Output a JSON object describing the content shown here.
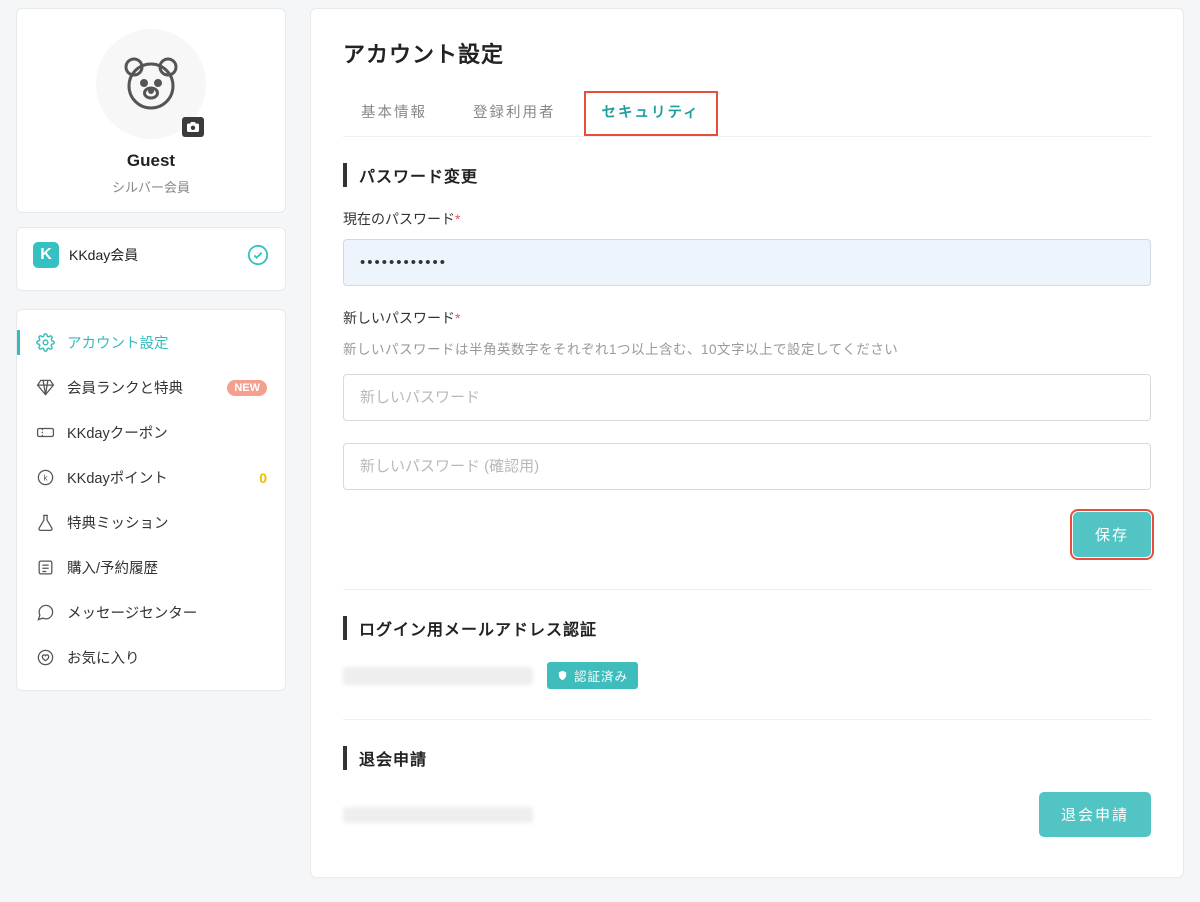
{
  "sidebar": {
    "username": "Guest",
    "member_tier": "シルバー会員",
    "member_card_title": "KKday会員",
    "nav": [
      {
        "label": "アカウント設定"
      },
      {
        "label": "会員ランクと特典",
        "badge": "NEW"
      },
      {
        "label": "KKdayクーポン"
      },
      {
        "label": "KKdayポイント",
        "points": "0"
      },
      {
        "label": "特典ミッション"
      },
      {
        "label": "購入/予約履歴"
      },
      {
        "label": "メッセージセンター"
      },
      {
        "label": "お気に入り"
      }
    ]
  },
  "main": {
    "title": "アカウント設定",
    "tabs": [
      {
        "label": "基本情報"
      },
      {
        "label": "登録利用者"
      },
      {
        "label": "セキュリティ"
      }
    ],
    "password_section": {
      "heading": "パスワード変更",
      "current_label": "現在のパスワード",
      "current_value": "••••••••••••",
      "new_label": "新しいパスワード",
      "helper": "新しいパスワードは半角英数字をそれぞれ1つ以上含む、10文字以上で設定してください",
      "new_placeholder": "新しいパスワード",
      "confirm_placeholder": "新しいパスワード (確認用)",
      "save_label": "保存"
    },
    "email_section": {
      "heading": "ログイン用メールアドレス認証",
      "verified_label": "認証済み"
    },
    "withdrawal_section": {
      "heading": "退会申請",
      "button_label": "退会申請"
    },
    "required_mark": "*"
  }
}
